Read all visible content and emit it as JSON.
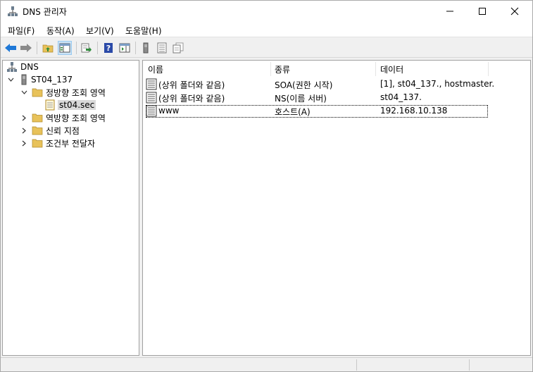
{
  "window": {
    "title": "DNS 관리자"
  },
  "menu": [
    "파일(F)",
    "동작(A)",
    "보기(V)",
    "도움말(H)"
  ],
  "toolbar": {
    "buttons": [
      "back-icon",
      "forward-icon",
      "up-folder-icon",
      "show-hide-tree-icon",
      "export-list-icon",
      "help-icon",
      "show-hide-action-pane-icon",
      "server-icon",
      "list-icon",
      "copy-icon"
    ]
  },
  "tree": {
    "root": "DNS",
    "server": "ST04_137",
    "forward_zones": "정방향 조회 영역",
    "zone": "st04.sec",
    "reverse_zones": "역방향 조회 영역",
    "trust_points": "신뢰 지점",
    "conditional_forwarders": "조건부 전달자"
  },
  "list": {
    "headers": [
      "이름",
      "종류",
      "데이터"
    ],
    "rows": [
      {
        "name": "(상위 폴더와 같음)",
        "type": "SOA(권한 시작)",
        "data": "[1], st04_137., hostmaster."
      },
      {
        "name": "(상위 폴더와 같음)",
        "type": "NS(이름 서버)",
        "data": "st04_137."
      },
      {
        "name": "www",
        "type": "호스트(A)",
        "data": "192.168.10.138"
      }
    ]
  },
  "colors": {
    "accent": "#1e78d7",
    "folder": "#e8c25a",
    "selection": "#d9d9d9"
  }
}
